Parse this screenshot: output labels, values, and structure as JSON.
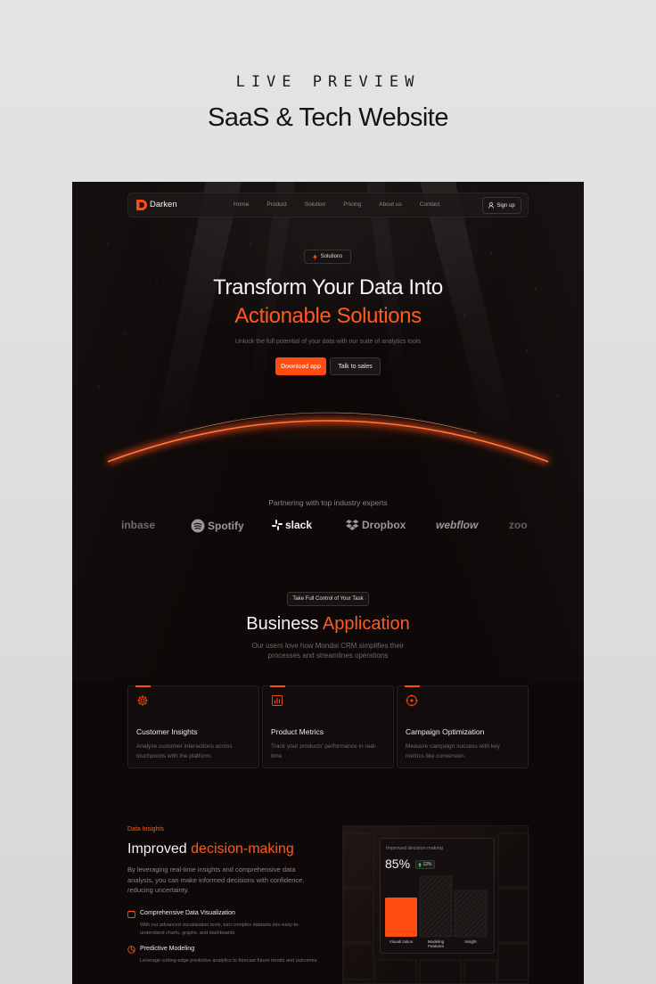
{
  "header": {
    "eyebrow": "LIVE PREVIEW",
    "title": "SaaS & Tech Website"
  },
  "colors": {
    "accent": "#ff4c12",
    "background": "#0e0908"
  },
  "navbar": {
    "brand": "Darken",
    "links": [
      "Home",
      "Product",
      "Solution",
      "Pricing",
      "About us",
      "Contact"
    ],
    "signup": "Sign up"
  },
  "hero": {
    "pill": "Solutions",
    "title_line1": "Transform Your Data Into",
    "title_line2": "Actionable Solutions",
    "subtitle": "Unlock the full potential of your data with our suite of analytics tools",
    "primary_button": "Download app",
    "secondary_button": "Talk to sales"
  },
  "partners": {
    "title": "Partnering with top industry experts",
    "logos": [
      "inbase",
      "Spotify",
      "slack",
      "Dropbox",
      "webflow",
      "zoo"
    ]
  },
  "business": {
    "pill": "Take Full Control of Your Task",
    "title_plain": "Business",
    "title_accent": "Application",
    "subtitle": "Our users love how Mondai CRM simplifies their processes and streamlines operations",
    "cards": [
      {
        "icon": "gear-icon",
        "title": "Customer Insights",
        "desc": "Analyze customer interactions across touchpoints with the platform."
      },
      {
        "icon": "bar-chart-icon",
        "title": "Product Metrics",
        "desc": "Track your products' performance in real-time."
      },
      {
        "icon": "target-icon",
        "title": "Campaign Optimization",
        "desc": "Measure campaign success with key metrics like conversion."
      }
    ]
  },
  "data_insights": {
    "label": "Data Insights",
    "title_plain": "Improved",
    "title_accent": "decision-making",
    "desc": "By leveraging real-time insights and comprehensive data analysis, you can make informed decisions with confidence, reducing uncertainty.",
    "items": [
      {
        "title": "Comprehensive Data Visualization",
        "desc": "With our advanced visualization tools, turn complex datasets into easy-to-understand charts, graphs, and dashboards"
      },
      {
        "title": "Predictive Modeling",
        "desc": "Leverage cutting-edge predictive analytics to forecast future trends and outcomes."
      }
    ],
    "widget": {
      "title": "Improved decision making",
      "value": "85%",
      "badge": "12%",
      "bars": [
        {
          "label": "Visuali zation",
          "value": 0.55,
          "highlight": true
        },
        {
          "label": "Modeling Features",
          "value": 0.85,
          "highlight": false
        },
        {
          "label": "Insight",
          "value": 0.65,
          "highlight": false
        }
      ]
    }
  }
}
